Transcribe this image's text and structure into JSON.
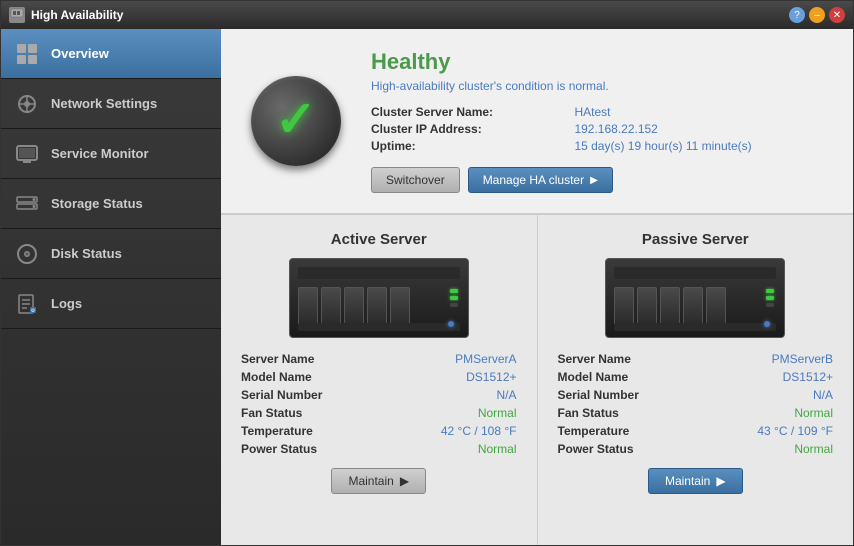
{
  "window": {
    "title": "High Availability"
  },
  "titlebar": {
    "help_label": "?",
    "min_label": "–",
    "close_label": "✕"
  },
  "sidebar": {
    "items": [
      {
        "id": "overview",
        "label": "Overview",
        "active": true
      },
      {
        "id": "network-settings",
        "label": "Network Settings",
        "active": false
      },
      {
        "id": "service-monitor",
        "label": "Service Monitor",
        "active": false
      },
      {
        "id": "storage-status",
        "label": "Storage Status",
        "active": false
      },
      {
        "id": "disk-status",
        "label": "Disk Status",
        "active": false
      },
      {
        "id": "logs",
        "label": "Logs",
        "active": false
      }
    ]
  },
  "overview": {
    "status_title": "Healthy",
    "status_desc": "High-availability cluster's condition is normal.",
    "cluster_server_name_label": "Cluster Server Name:",
    "cluster_server_name_value": "HAtest",
    "cluster_ip_label": "Cluster IP Address:",
    "cluster_ip_value": "192.168.22.152",
    "uptime_label": "Uptime:",
    "uptime_value": "15 day(s) 19 hour(s) 11 minute(s)",
    "switchover_btn": "Switchover",
    "manage_btn": "Manage HA cluster"
  },
  "servers": {
    "active": {
      "title": "Active Server",
      "server_name_label": "Server Name",
      "server_name_value": "PMServerA",
      "model_name_label": "Model Name",
      "model_name_value": "DS1512+",
      "serial_number_label": "Serial Number",
      "serial_number_value": "N/A",
      "fan_status_label": "Fan Status",
      "fan_status_value": "Normal",
      "temperature_label": "Temperature",
      "temperature_value": "42 °C / 108 °F",
      "power_status_label": "Power Status",
      "power_status_value": "Normal",
      "maintain_btn": "Maintain"
    },
    "passive": {
      "title": "Passive Server",
      "server_name_label": "Server Name",
      "server_name_value": "PMServerB",
      "model_name_label": "Model Name",
      "model_name_value": "DS1512+",
      "serial_number_label": "Serial Number",
      "serial_number_value": "N/A",
      "fan_status_label": "Fan Status",
      "fan_status_value": "Normal",
      "temperature_label": "Temperature",
      "temperature_value": "43 °C / 109 °F",
      "power_status_label": "Power Status",
      "power_status_value": "Normal",
      "maintain_btn": "Maintain"
    }
  },
  "colors": {
    "healthy": "#4a9a4a",
    "link_blue": "#4a7abf",
    "normal_green": "#40a840",
    "sidebar_active": "#3a6fa0"
  }
}
